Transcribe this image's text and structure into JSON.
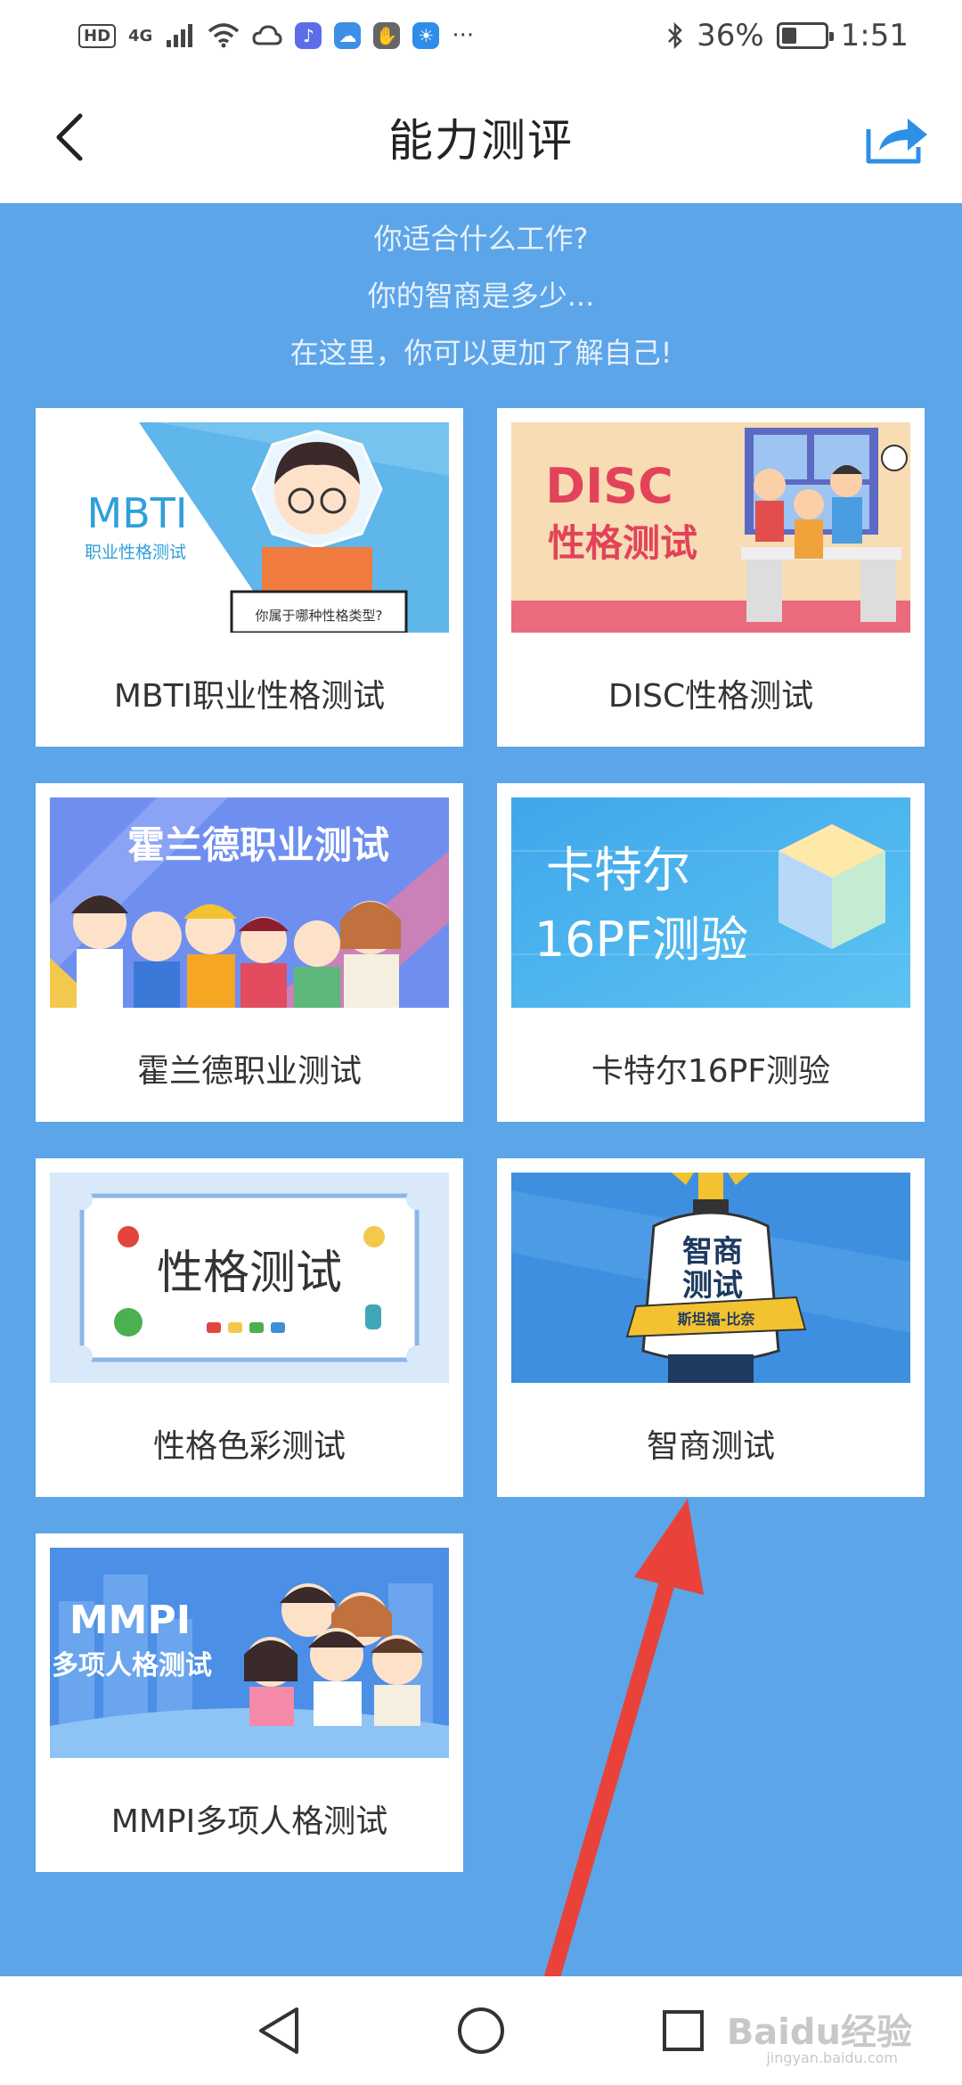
{
  "status_bar": {
    "hd": "HD",
    "network": "4G",
    "battery_text": "36%",
    "battery_level": 0.36,
    "time": "1:51",
    "icons": [
      "signal-icon",
      "wifi-icon",
      "cloud-icon",
      "music-icon",
      "cloud-app-icon",
      "hand-icon",
      "weather-icon",
      "more-icon",
      "bluetooth-icon",
      "battery-icon"
    ]
  },
  "header": {
    "title": "能力测评",
    "back_icon": "chevron-left-icon",
    "share_icon": "share-icon"
  },
  "intro": {
    "line1": "你适合什么工作?",
    "line2": "你的智商是多少...",
    "line3": "在这里，你可以更加了解自己!"
  },
  "cards": [
    {
      "label": "MBTI职业性格测试",
      "img_title": "MBTI",
      "img_subtitle": "职业性格测试",
      "img_caption": "你属于哪种性格类型?",
      "bg": "#5eb6ea"
    },
    {
      "label": "DISC性格测试",
      "img_title": "DISC",
      "img_subtitle": "性格测试",
      "bg": "#f7dcb4"
    },
    {
      "label": "霍兰德职业测试",
      "img_title": "霍兰德职业测试",
      "bg": "#6f8ff0"
    },
    {
      "label": "卡特尔16PF测验",
      "img_title": "卡特尔",
      "img_subtitle": "16PF测验",
      "bg": "#4fb2ec"
    },
    {
      "label": "性格色彩测试",
      "img_title": "性格测试",
      "bg": "#d9e9fa"
    },
    {
      "label": "智商测试",
      "img_title": "智商",
      "img_subtitle": "测试",
      "img_caption": "斯坦福-比奈",
      "bg": "#3e8fe0"
    },
    {
      "label": "MMPI多项人格测试",
      "img_title": "MMPI",
      "img_subtitle": "多项人格测试",
      "bg": "#4b8fe6"
    }
  ],
  "nav": {
    "back_icon": "triangle-back-icon",
    "home_icon": "circle-home-icon",
    "recent_icon": "square-recent-icon"
  },
  "watermark": {
    "text": "Baidu经验",
    "sub": "jingyan.baidu.com"
  }
}
